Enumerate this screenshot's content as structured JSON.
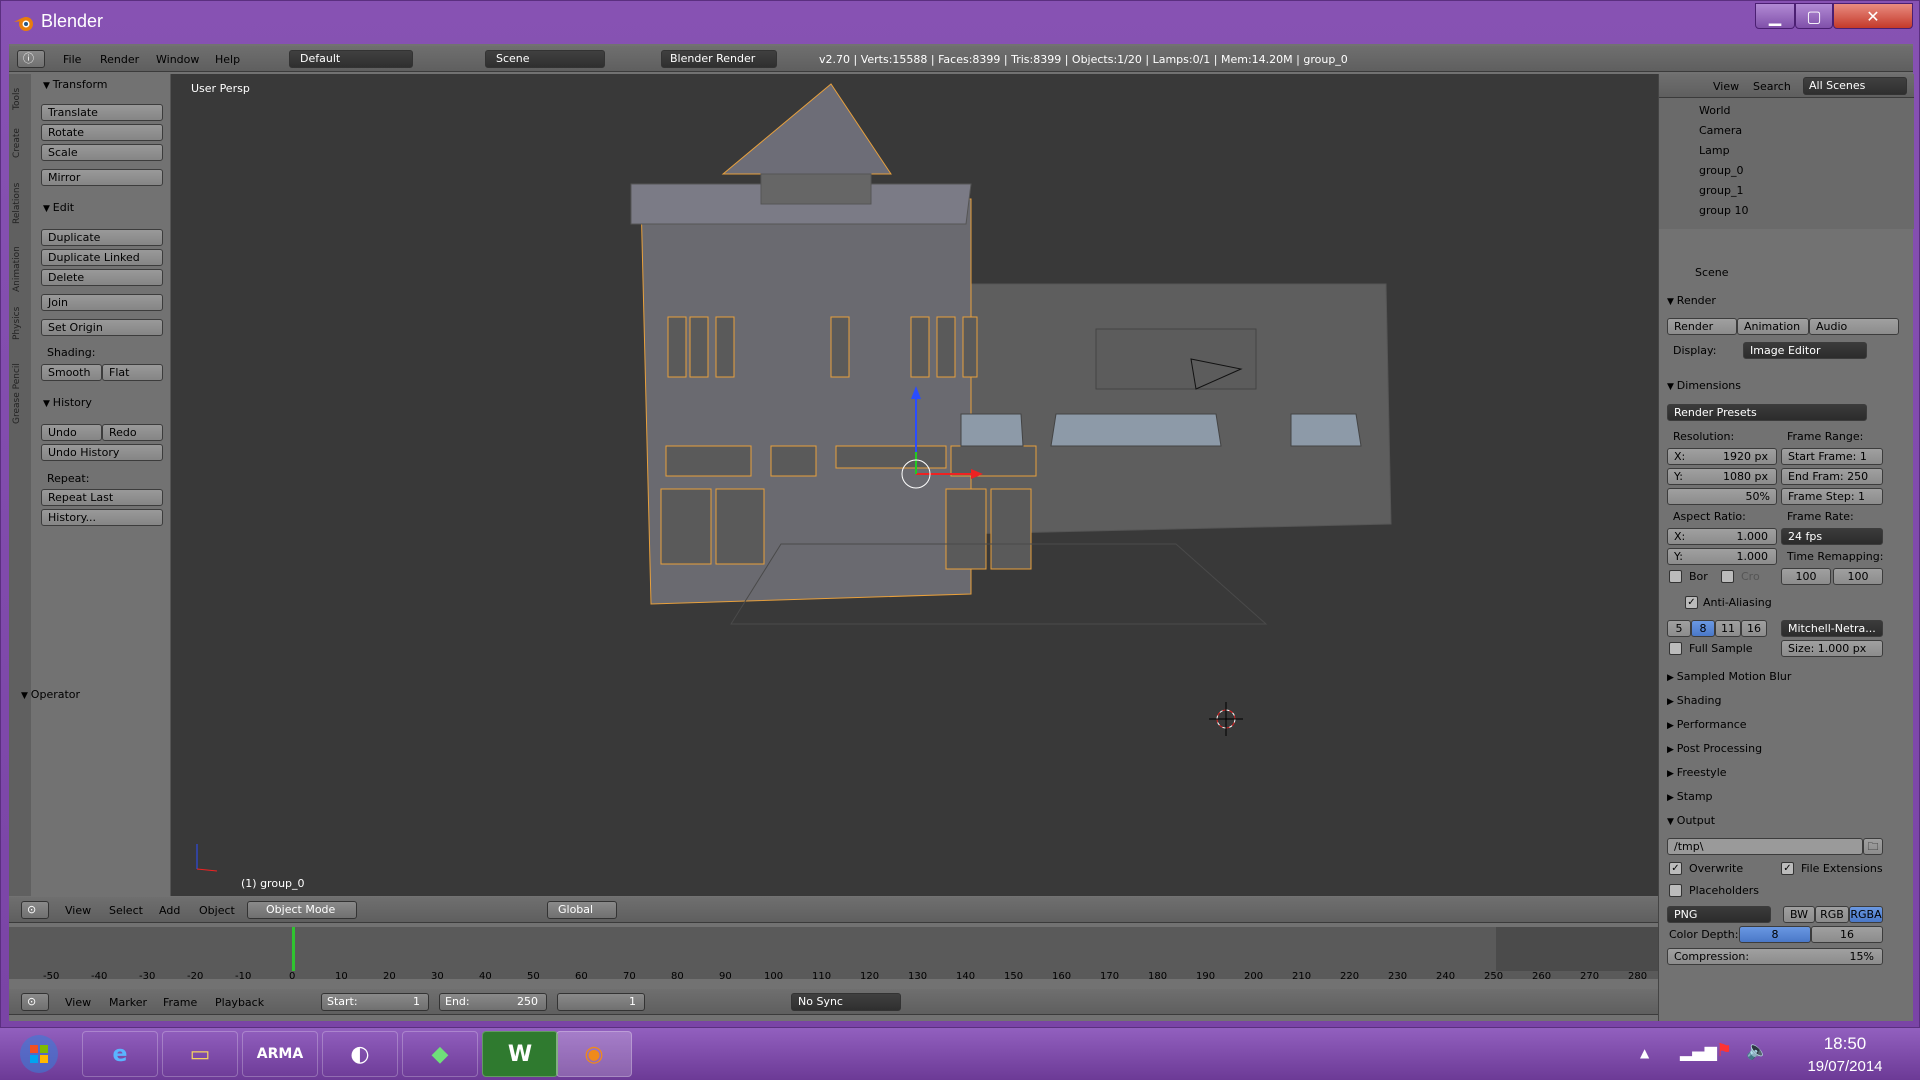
{
  "window": {
    "title": "Blender"
  },
  "info_header": {
    "menus": [
      "File",
      "Render",
      "Window",
      "Help"
    ],
    "layout": "Default",
    "scene": "Scene",
    "engine": "Blender Render",
    "stats": "v2.70 | Verts:15588 | Faces:8399 | Tris:8399 | Objects:1/20 | Lamps:0/1 | Mem:14.20M | group_0"
  },
  "vertical_tabs": [
    "Tools",
    "Create",
    "Relations",
    "Animation",
    "Physics",
    "Grease Pencil"
  ],
  "tools_panel": {
    "transform": {
      "title": "Transform",
      "buttons": [
        "Translate",
        "Rotate",
        "Scale",
        "Mirror"
      ]
    },
    "edit": {
      "title": "Edit",
      "buttons": [
        "Duplicate",
        "Duplicate Linked",
        "Delete",
        "Join",
        "Set Origin"
      ],
      "shading_label": "Shading:",
      "smooth": "Smooth",
      "flat": "Flat"
    },
    "history": {
      "title": "History",
      "undo": "Undo",
      "redo": "Redo",
      "undo_history": "Undo History",
      "repeat_label": "Repeat:",
      "repeat_last": "Repeat Last",
      "history_btn": "History..."
    },
    "operator": "Operator"
  },
  "viewport": {
    "label": "User Persp",
    "active_object": "(1) group_0"
  },
  "view3d_header": {
    "menus": [
      "View",
      "Select",
      "Add",
      "Object"
    ],
    "mode": "Object Mode",
    "orientation": "Global"
  },
  "timeline": {
    "ticks": [
      "-50",
      "-40",
      "-30",
      "-20",
      "-10",
      "0",
      "10",
      "20",
      "30",
      "40",
      "50",
      "60",
      "70",
      "80",
      "90",
      "100",
      "110",
      "120",
      "130",
      "140",
      "150",
      "160",
      "170",
      "180",
      "190",
      "200",
      "210",
      "220",
      "230",
      "240",
      "250",
      "260",
      "270",
      "280"
    ],
    "current_frame": 0
  },
  "timeline_header": {
    "menus": [
      "View",
      "Marker",
      "Frame",
      "Playback"
    ],
    "start": "Start:",
    "start_val": "1",
    "end": "End:",
    "end_val": "250",
    "current": "1",
    "sync": "No Sync"
  },
  "outliner": {
    "menus": [
      "View",
      "Search"
    ],
    "scenes": "All Scenes",
    "items": [
      "World",
      "Camera",
      "Lamp",
      "group_0",
      "group_1",
      "group 10"
    ]
  },
  "properties": {
    "context": "Scene",
    "render": {
      "title": "Render",
      "render_btn": "Render",
      "animation_btn": "Animation",
      "audio_btn": "Audio",
      "display_label": "Display:",
      "display": "Image Editor"
    },
    "dimensions": {
      "title": "Dimensions",
      "presets": "Render Presets",
      "resolution_label": "Resolution:",
      "res_x": "X:",
      "res_x_val": "1920 px",
      "res_y": "Y:",
      "res_y_val": "1080 px",
      "res_pct": "50%",
      "frame_range_label": "Frame Range:",
      "start_frame": "Start Frame: 1",
      "end_frame": "End Fram: 250",
      "frame_step": "Frame Step: 1",
      "aspect_label": "Aspect Ratio:",
      "asp_x": "X:",
      "asp_x_val": "1.000",
      "asp_y": "Y:",
      "asp_y_val": "1.000",
      "frame_rate_label": "Frame Rate:",
      "frame_rate": "24 fps",
      "time_remap_label": "Time Remapping:",
      "remap_old": "100",
      "remap_new": "100",
      "border": "Bor",
      "crop": "Cro"
    },
    "anti_aliasing": {
      "title": "Anti-Aliasing",
      "samples": [
        "5",
        "8",
        "11",
        "16"
      ],
      "selected": "8",
      "filter": "Mitchell-Netra...",
      "full_sample": "Full Sample",
      "size": "Size: 1.000 px"
    },
    "collapsed": [
      "Sampled Motion Blur",
      "Shading",
      "Performance",
      "Post Processing",
      "Freestyle",
      "Stamp"
    ],
    "output": {
      "title": "Output",
      "path": "/tmp\\",
      "overwrite": "Overwrite",
      "file_extensions": "File Extensions",
      "placeholders": "Placeholders",
      "format": "PNG",
      "bw": "BW",
      "rgb": "RGB",
      "rgba": "RGBA",
      "color_depth_label": "Color Depth:",
      "depth_8": "8",
      "depth_16": "16",
      "compression": "Compression:",
      "compression_val": "15%"
    }
  },
  "taskbar": {
    "time": "18:50",
    "date": "19/07/2014",
    "apps": [
      "start",
      "ie",
      "explorer",
      "arma",
      "steam",
      "sims",
      "w",
      "blender"
    ]
  }
}
